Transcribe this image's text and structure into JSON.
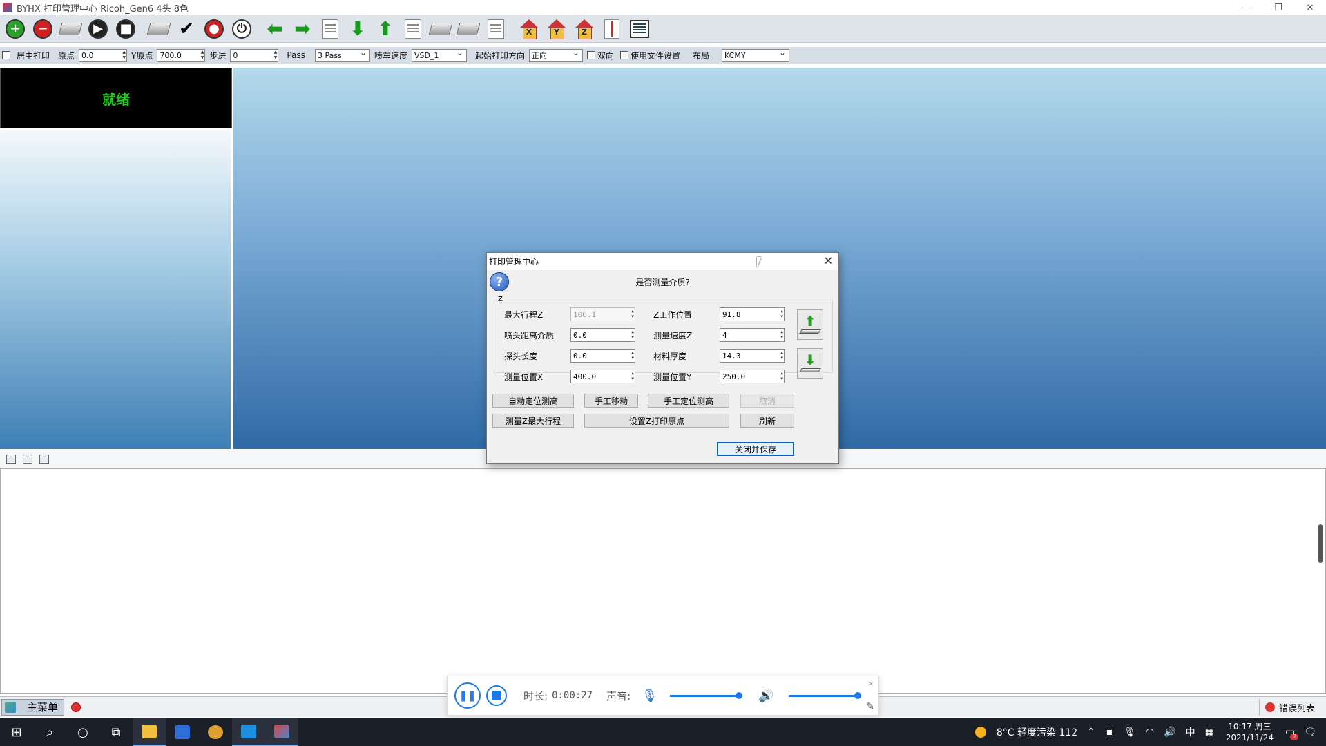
{
  "window": {
    "title": "BYHX  打印管理中心 Ricoh_Gen6 4头 8色",
    "controls": [
      "—",
      "❐",
      "✕"
    ]
  },
  "options_bar": {
    "center_print_label": "居中打印",
    "origin_label": "原点",
    "origin_value": "0.0",
    "y_origin_label": "Y原点",
    "y_origin_value": "700.0",
    "step_label": "步进",
    "step_value": "0",
    "pass_label": "Pass",
    "pass_value": "3 Pass",
    "jet_speed_label": "喷车速度",
    "jet_speed_value": "VSD_1",
    "start_direction_label": "起始打印方向",
    "start_direction_value": "正向",
    "bidirectional_label": "双向",
    "use_file_settings_label": "使用文件设置",
    "layout_label": "布局",
    "layout_value": "KCMY"
  },
  "status_panel": {
    "text": "就绪"
  },
  "dialog": {
    "title": "打印管理中心",
    "question": "是否测量介质?",
    "group_label": "Z",
    "fields": {
      "max_travel_z": {
        "label": "最大行程Z",
        "value": "106.1"
      },
      "head_distance": {
        "label": "喷头距离介质",
        "value": "0.0"
      },
      "probe_length": {
        "label": "探头长度",
        "value": "0.0"
      },
      "measure_pos_x": {
        "label": "测量位置X",
        "value": "400.0"
      },
      "z_work_pos": {
        "label": "Z工作位置",
        "value": "91.8"
      },
      "measure_speed_z": {
        "label": "测量速度Z",
        "value": "4"
      },
      "material_thickness": {
        "label": "材料厚度",
        "value": "14.3"
      },
      "measure_pos_y": {
        "label": "测量位置Y",
        "value": "250.0"
      }
    },
    "buttons": {
      "auto_measure": "自动定位测高",
      "manual_move": "手工移动",
      "manual_measure": "手工定位测高",
      "cancel": "取消",
      "measure_z_max": "测量Z最大行程",
      "set_z_origin": "设置Z打印原点",
      "refresh": "刷新",
      "close_save": "关闭并保存"
    },
    "close_glyph": "✕"
  },
  "status_strip": {
    "main_menu": "主菜单",
    "error_list": "错误列表"
  },
  "recorder": {
    "duration_label": "时长:",
    "duration_value": "0:00:27",
    "sound_label": "声音:",
    "mic_level": 1.0,
    "speaker_level": 1.0,
    "close_glyph": "×"
  },
  "taskbar": {
    "weather": "8°C  轻度污染 112",
    "ime": "中",
    "time": "10:17 周三",
    "date": "2021/11/24",
    "notification_count": "2"
  },
  "colors": {
    "status_text": "#22cc22",
    "accent": "#1e7ae6",
    "taskbar": "#1b1f27"
  }
}
